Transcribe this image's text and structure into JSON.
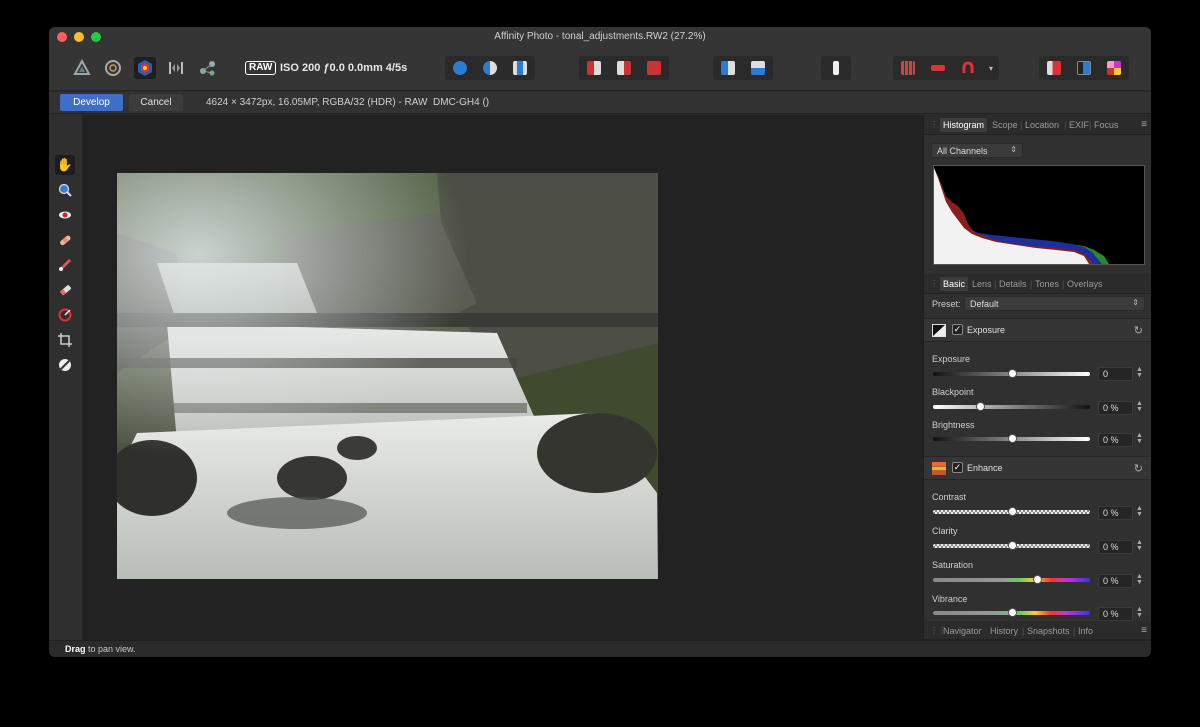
{
  "window": {
    "title": "Affinity Photo - tonal_adjustments.RW2 (27.2%)"
  },
  "toolbar": {
    "personas": [
      {
        "icon": "photo-persona-icon"
      },
      {
        "icon": "liquify-persona-icon"
      },
      {
        "icon": "develop-persona-icon"
      },
      {
        "icon": "tone-mapping-persona-icon"
      },
      {
        "icon": "export-persona-icon"
      }
    ],
    "raw_badge": "RAW",
    "raw_info": "ISO 200 ƒ0.0 0.0mm 4/5s"
  },
  "context_bar": {
    "develop_label": "Develop",
    "cancel_label": "Cancel",
    "image_info": "4624 × 3472px, 16.05MP, RGBA/32 (HDR) - RAW",
    "camera": "DMC-GH4 ()"
  },
  "tools": [
    {
      "icon": "hand-tool-icon"
    },
    {
      "icon": "zoom-tool-icon"
    },
    {
      "icon": "red-eye-tool-icon"
    },
    {
      "icon": "blemish-tool-icon"
    },
    {
      "icon": "overlay-paint-tool-icon"
    },
    {
      "icon": "overlay-erase-tool-icon"
    },
    {
      "icon": "overlay-gradient-tool-icon"
    },
    {
      "icon": "crop-tool-icon"
    },
    {
      "icon": "white-balance-tool-icon"
    }
  ],
  "panel_top": {
    "tabs": [
      "Histogram",
      "Scope",
      "Location",
      "EXIF",
      "Focus"
    ],
    "active_tab": "Histogram",
    "channel_select": "All Channels"
  },
  "panel_adjust": {
    "tabs": [
      "Basic",
      "Lens",
      "Details",
      "Tones",
      "Overlays"
    ],
    "active_tab": "Basic",
    "preset_label": "Preset:",
    "preset_value": "Default",
    "exposure_section": {
      "label": "Exposure",
      "enabled": true,
      "rows": [
        {
          "label": "Exposure",
          "value": "0",
          "position": 0.5
        },
        {
          "label": "Blackpoint",
          "value": "0 %",
          "position": 0.3
        },
        {
          "label": "Brightness",
          "value": "0 %",
          "position": 0.5
        }
      ]
    },
    "enhance_section": {
      "label": "Enhance",
      "enabled": true,
      "rows": [
        {
          "label": "Contrast",
          "value": "0 %",
          "position": 0.5
        },
        {
          "label": "Clarity",
          "value": "0 %",
          "position": 0.5
        },
        {
          "label": "Saturation",
          "value": "0 %",
          "position": 0.66
        },
        {
          "label": "Vibrance",
          "value": "0 %",
          "position": 0.5
        }
      ]
    }
  },
  "panel_bottom": {
    "tabs": [
      "Navigator",
      "History",
      "Snapshots",
      "Info"
    ]
  },
  "status": {
    "bold": "Drag",
    "text": " to pan view."
  },
  "colors": {
    "accent": "#3d6fc9",
    "background": "#2b2b2b",
    "canvas": "#222222"
  }
}
